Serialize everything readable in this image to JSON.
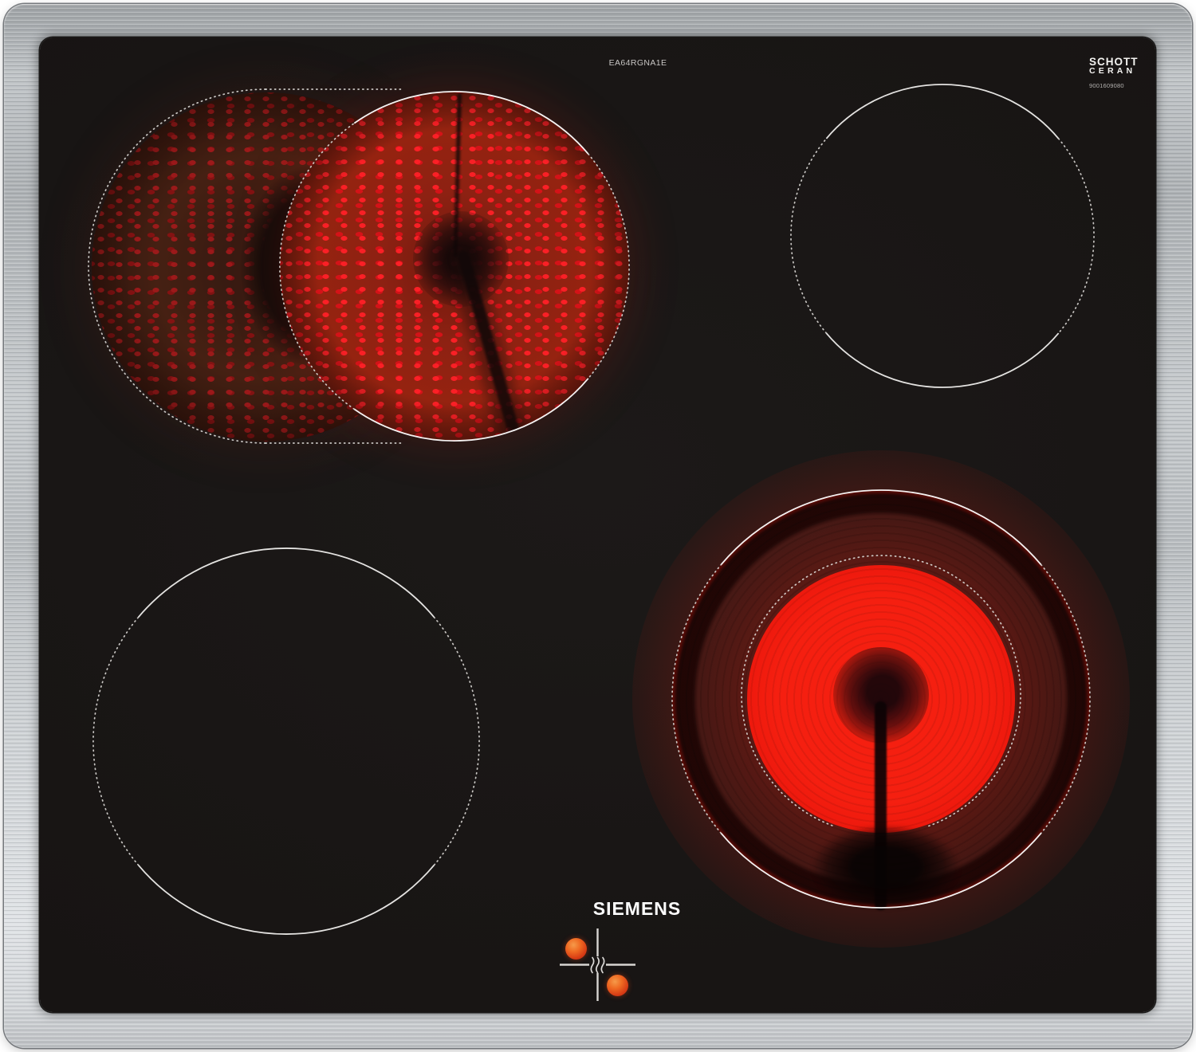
{
  "product": {
    "brand": "SIEMENS",
    "model": "EA64RGNA1E"
  },
  "glass_branding": {
    "maker": "SCHOTT",
    "material": "CERAN",
    "code": "9001609080"
  },
  "cooking_zones": [
    {
      "id": "rear-left",
      "type": "dual extendable zone",
      "state": "on",
      "detail": "main circle glowing bright red, left extension crescent glowing dim"
    },
    {
      "id": "rear-right",
      "type": "single zone",
      "state": "off"
    },
    {
      "id": "front-left",
      "type": "single zone",
      "state": "off"
    },
    {
      "id": "front-right",
      "type": "dual-circuit zone",
      "state": "on",
      "detail": "outer ring and inner disc glowing bright red"
    }
  ],
  "residual_heat_indicator": {
    "icon": "heat-waves-icon",
    "lit_dots": 2,
    "dot_color": "#e05a20"
  },
  "colors": {
    "frame_steel": "#cdd1d4",
    "glass": "#171413",
    "glow_bright": "#f52012",
    "glow_dim": "#cf2418",
    "zone_outline": "#e4e2df",
    "logo_text": "#ffffff"
  }
}
